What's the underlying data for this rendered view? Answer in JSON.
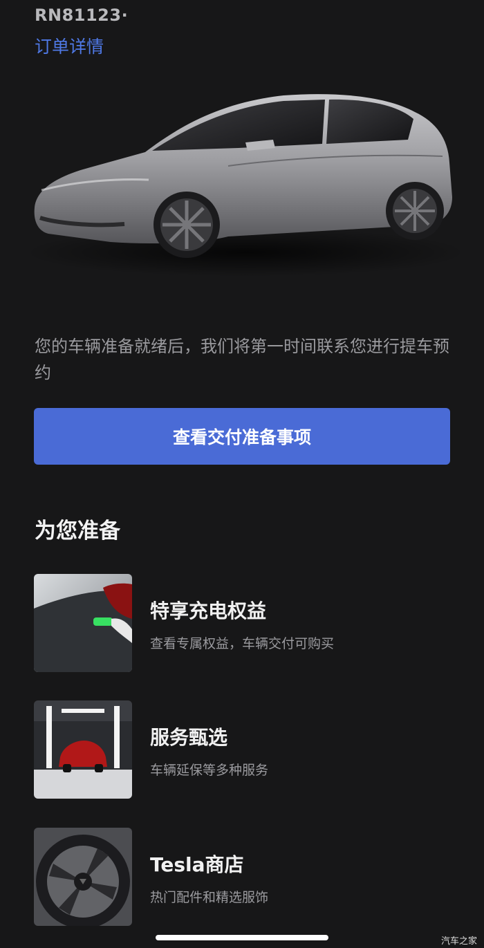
{
  "order": {
    "id": "RN81123·",
    "details_link": "订单详情"
  },
  "hero": {
    "car_image": "car-image"
  },
  "notice": {
    "text": "您的车辆准备就绪后，我们将第一时间联系您进行提车预约"
  },
  "primary_button": {
    "label": "查看交付准备事项"
  },
  "section": {
    "title": "为您准备"
  },
  "cards": [
    {
      "title": "特享充电权益",
      "desc": "查看专属权益，车辆交付可购买",
      "image": "charging-image"
    },
    {
      "title": "服务甄选",
      "desc": "车辆延保等多种服务",
      "image": "service-image"
    },
    {
      "title": "Tesla商店",
      "desc": "热门配件和精选服饰",
      "image": "wheel-image"
    }
  ],
  "watermark": "汽车之家",
  "colors": {
    "background": "#171718",
    "accent": "#4a6bd6",
    "link": "#4f79e6"
  }
}
